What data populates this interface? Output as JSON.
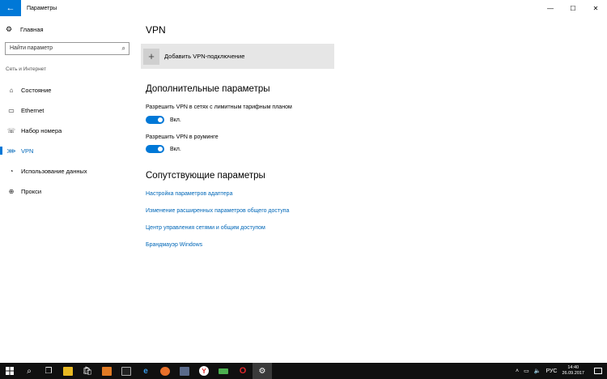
{
  "window": {
    "title": "Параметры",
    "back_icon": "←",
    "minimize": "—",
    "maximize": "☐",
    "close": "✕"
  },
  "sidebar": {
    "home_label": "Главная",
    "search_placeholder": "Найти параметр",
    "section_label": "Сеть и Интернет",
    "items": [
      {
        "label": "Состояние",
        "icon": "⌂"
      },
      {
        "label": "Ethernet",
        "icon": "▭"
      },
      {
        "label": "Набор номера",
        "icon": "☏"
      },
      {
        "label": "VPN",
        "icon": "⋙"
      },
      {
        "label": "Использование данных",
        "icon": "◔"
      },
      {
        "label": "Прокси",
        "icon": "⊕"
      }
    ],
    "active_item": "VPN"
  },
  "main": {
    "title": "VPN",
    "add_vpn_label": "Добавить VPN-подключение",
    "advanced_heading": "Дополнительные параметры",
    "metered_label": "Разрешить VPN в сетях с лимитным тарифным планом",
    "metered_state": "Вкл.",
    "roaming_label": "Разрешить VPN в роуминге",
    "roaming_state": "Вкл.",
    "related_heading": "Сопутствующие параметры",
    "links": [
      "Настройка параметров адаптера",
      "Изменение расширенных параметров общего доступа",
      "Центр управления сетями и общим доступом",
      "Брандмауэр Windows"
    ]
  },
  "taskbar": {
    "language": "РУС",
    "time": "14:40",
    "date": "26.09.2017",
    "colors": {
      "accent": "#0078d7",
      "taskbar_bg": "#101010"
    }
  }
}
